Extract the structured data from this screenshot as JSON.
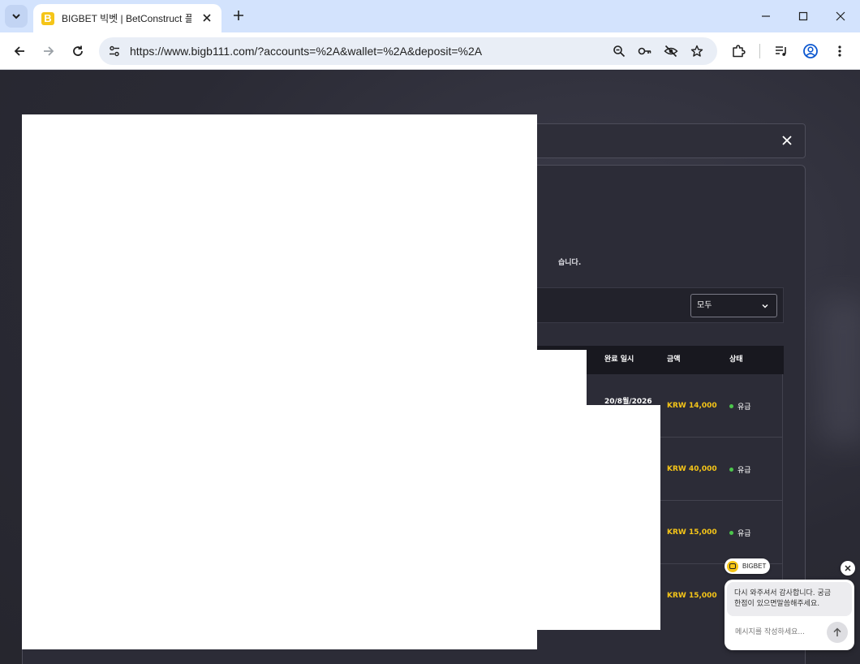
{
  "browser": {
    "tab_title": "BIGBET 빅벳 | BetConstruct 플",
    "tab_favicon_letter": "B",
    "url": "https://www.bigb111.com/?accounts=%2A&wallet=%2A&deposit=%2A",
    "icons": {
      "tab_menu": "chevron-down-icon",
      "close_tab": "close-icon",
      "new_tab": "plus-icon",
      "minimize": "minimize-icon",
      "maximize": "maximize-icon",
      "close_window": "close-icon",
      "back": "back-arrow-icon",
      "forward": "forward-arrow-icon",
      "reload": "reload-icon",
      "site_info": "tune-icon",
      "zoom": "zoom-out-icon",
      "passwords": "key-icon",
      "tracking": "eye-off-icon",
      "bookmark": "star-icon",
      "extensions": "puzzle-icon",
      "media": "media-queue-icon",
      "profile": "profile-icon",
      "menu": "kebab-menu-icon"
    }
  },
  "modal": {
    "notice": "습니다.",
    "filter": {
      "selected": "모두"
    },
    "table": {
      "columns": [
        "완료 일시",
        "금액",
        "상태"
      ],
      "rows": [
        {
          "date": "20/8월/2026",
          "amount": "KRW 14,000",
          "status": "유급"
        },
        {
          "date": "",
          "amount": "KRW 40,000",
          "status": "유급"
        },
        {
          "date": "",
          "amount": "KRW 15,000",
          "status": "유급"
        },
        {
          "date": "",
          "amount": "KRW 15,000",
          "status": ""
        }
      ]
    }
  },
  "chat": {
    "brand": "BIGBET",
    "message_line1": "다시 와주셔서 감사합니다. 궁금",
    "message_line2": "한점이 있으면말씀해주세요.",
    "input_placeholder": "메시지를 작성하세요..."
  },
  "colors": {
    "accent_yellow": "#f5c518",
    "status_green": "#4cc64c",
    "chrome_blue": "#d3e3fd"
  }
}
